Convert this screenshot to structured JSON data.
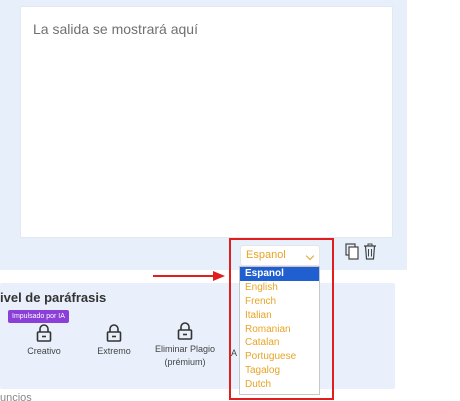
{
  "output": {
    "placeholder": "La salida se mostrará aquí"
  },
  "language_select": {
    "selected": "Espanol",
    "options": [
      "Espanol",
      "English",
      "French",
      "Italian",
      "Romanian",
      "Catalan",
      "Portuguese",
      "Tagalog",
      "Dutch"
    ]
  },
  "level": {
    "title": "ivel de paráfrasis",
    "badge": "Impulsado por IA",
    "modes": [
      {
        "label": "Creativo"
      },
      {
        "label": "Extremo"
      },
      {
        "label": "Eliminar Plagio",
        "sub": "(prémium)"
      },
      {
        "label": "A"
      }
    ]
  },
  "bottom_text": "uncios",
  "colors": {
    "accent_orange": "#e8a427",
    "selection_blue": "#1f5fd0",
    "highlight_red": "#e01e1e",
    "badge_purple": "#8a3fd8",
    "panel_bg": "#e7effa"
  },
  "icons": [
    "copy-icon",
    "trash-icon",
    "lock-icon",
    "chevron-down-icon",
    "arrow-icon"
  ]
}
